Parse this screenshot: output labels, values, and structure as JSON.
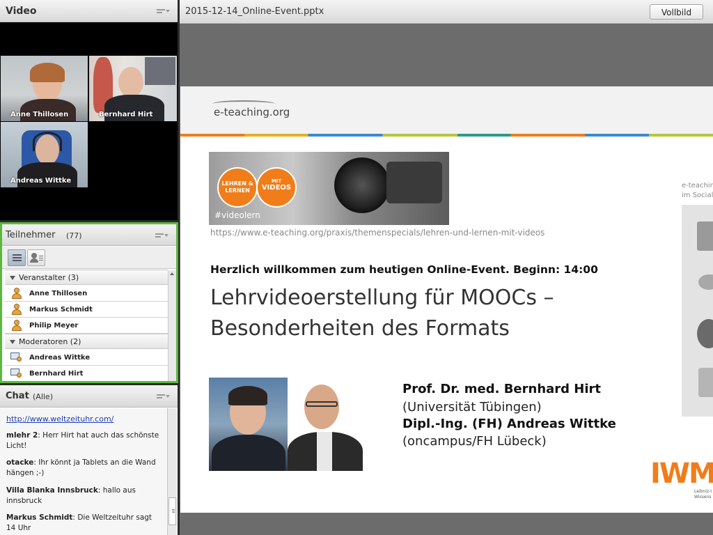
{
  "video": {
    "title": "Video",
    "participants": [
      {
        "name": "Anne Thillosen"
      },
      {
        "name": "Bernhard Hirt"
      },
      {
        "name": "Andreas Wittke"
      }
    ]
  },
  "attendees": {
    "title": "Teilnehmer",
    "count": "(77)",
    "groups": [
      {
        "label": "Veranstalter (3)",
        "members": [
          "Anne Thillosen",
          "Markus Schmidt",
          "Philip Meyer"
        ]
      },
      {
        "label": "Moderatoren (2)",
        "members": [
          "Andreas Wittke",
          "Bernhard Hirt"
        ]
      }
    ]
  },
  "chat": {
    "title": "Chat",
    "filter": "(Alle)",
    "link": "http://www.weltzeituhr.com/",
    "messages": [
      {
        "author": "mlehr 2",
        "text": "Herr Hirt hat auch das schönste Licht!"
      },
      {
        "author": "otacke",
        "text": "Ihr könnt ja Tablets an die Wand hängen ;-)"
      },
      {
        "author": "Villa Blanka Innsbruck",
        "text": "hallo aus innsbruck"
      },
      {
        "author": "Markus Schmidt",
        "text": "Die Weltzeituhr sagt 14 Uhr"
      }
    ]
  },
  "share": {
    "title": "2015-12-14_Online-Event.pptx",
    "fullscreen_label": "Vollbild"
  },
  "slide": {
    "logo_text": "e-teaching.org",
    "badge_left": "LEHREN & LERNEN",
    "badge_right_small": "MIT",
    "badge_right_big": "VIDEOS",
    "hashtag": "#videolern",
    "url": "https://www.e-teaching.org/praxis/themenspecials/lehren-und-lernen-mit-videos",
    "welcome": "Herzlich willkommen zum heutigen Online-Event. Beginn: 14:00",
    "title_line1": "Lehrvideoerstellung für MOOCs –",
    "title_line2": "Besonderheiten des Formats",
    "speaker1_name": "Prof. Dr. med. Bernhard Hirt",
    "speaker1_affil": "(Universität Tübingen)",
    "speaker2_name": "Dipl.-Ing. (FH) Andreas Wittke",
    "speaker2_affil": "(oncampus/FH Lübeck)",
    "sidebar_text1": "e-teachin",
    "sidebar_text2": "im Social",
    "iwm_logo": "IWM",
    "iwm_sub1": "Leibniz-I",
    "iwm_sub2": "Wissens"
  },
  "colors": {
    "accent_green": "#5ab93c",
    "slide_orange": "#f07d1a",
    "slide_blue": "#1e3e6b"
  }
}
